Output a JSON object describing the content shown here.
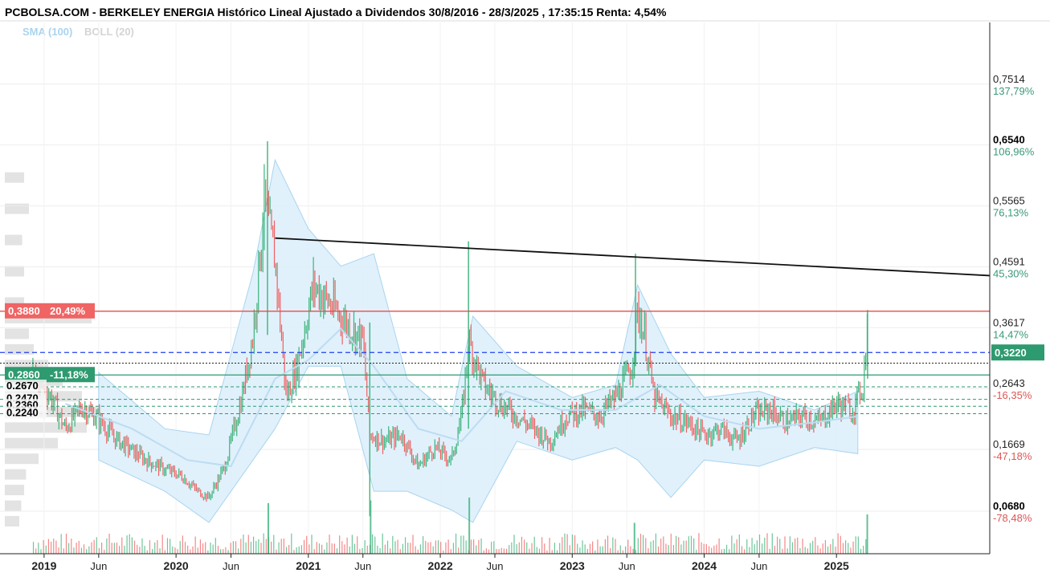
{
  "title": "PCBOLSA.COM - BERKELEY ENERGIA Histórico Lineal Ajustado a Dividendos 30/8/2016 - 28/3/2025 , 17:35:15 Renta: 4,54%",
  "legend": {
    "sma": "SMA (100)",
    "boll": "BOLL (20)"
  },
  "colors": {
    "up": "#3cb37a",
    "down": "#f06060",
    "band_fill": "#dbeefb",
    "band_line": "#a9d4ef",
    "resistance": "#e74c4c",
    "support": "#2e9a6f",
    "blue_dash": "#1f3ff0",
    "trendline": "#111111"
  },
  "chart_data": {
    "type": "line",
    "scale": "linear",
    "x_range": [
      "2018-09-01",
      "2026-03-01"
    ],
    "y_range": [
      0.0,
      0.85
    ],
    "x_ticks": [
      {
        "label": "2019",
        "date": "2019-01-01",
        "kind": "year"
      },
      {
        "label": "Jun",
        "date": "2019-06-01",
        "kind": "month"
      },
      {
        "label": "2020",
        "date": "2020-01-01",
        "kind": "year"
      },
      {
        "label": "Jun",
        "date": "2020-06-01",
        "kind": "month"
      },
      {
        "label": "2021",
        "date": "2021-01-01",
        "kind": "year"
      },
      {
        "label": "Jun",
        "date": "2021-06-01",
        "kind": "month"
      },
      {
        "label": "2022",
        "date": "2022-01-01",
        "kind": "year"
      },
      {
        "label": "Jun",
        "date": "2022-06-01",
        "kind": "month"
      },
      {
        "label": "2023",
        "date": "2023-01-01",
        "kind": "year"
      },
      {
        "label": "Jun",
        "date": "2023-06-01",
        "kind": "month"
      },
      {
        "label": "2024",
        "date": "2024-01-01",
        "kind": "year"
      },
      {
        "label": "Jun",
        "date": "2024-06-01",
        "kind": "month"
      },
      {
        "label": "2025",
        "date": "2025-01-01",
        "kind": "year"
      }
    ],
    "y_ticks": [
      {
        "price": 0.7514,
        "label": "0,7514",
        "pct": "137,79%",
        "bold": false
      },
      {
        "price": 0.654,
        "label": "0,6540",
        "pct": "106,96%",
        "bold": true
      },
      {
        "price": 0.5565,
        "label": "0,5565",
        "pct": "76,13%",
        "bold": false
      },
      {
        "price": 0.4591,
        "label": "0,4591",
        "pct": "45,30%",
        "bold": false
      },
      {
        "price": 0.3617,
        "label": "0,3617",
        "pct": "14,47%",
        "bold": false
      },
      {
        "price": 0.2643,
        "label": "0,2643",
        "pct": "-16,35%",
        "bold": false
      },
      {
        "price": 0.1669,
        "label": "0,1669",
        "pct": "-47,18%",
        "bold": false
      },
      {
        "price": 0.068,
        "label": "0,0680",
        "pct": "-78,48%",
        "bold": true
      }
    ],
    "price_series": [
      {
        "date": "2018-12-01",
        "close": 0.29
      },
      {
        "date": "2019-01-15",
        "close": 0.255
      },
      {
        "date": "2019-03-01",
        "close": 0.2
      },
      {
        "date": "2019-04-15",
        "close": 0.235
      },
      {
        "date": "2019-06-01",
        "close": 0.215
      },
      {
        "date": "2019-07-15",
        "close": 0.185
      },
      {
        "date": "2019-09-01",
        "close": 0.165
      },
      {
        "date": "2019-10-15",
        "close": 0.148
      },
      {
        "date": "2019-12-01",
        "close": 0.135
      },
      {
        "date": "2020-01-15",
        "close": 0.125
      },
      {
        "date": "2020-03-01",
        "close": 0.1
      },
      {
        "date": "2020-04-01",
        "close": 0.09
      },
      {
        "date": "2020-05-15",
        "close": 0.14
      },
      {
        "date": "2020-07-01",
        "close": 0.25
      },
      {
        "date": "2020-08-01",
        "close": 0.35
      },
      {
        "date": "2020-09-01",
        "close": 0.56
      },
      {
        "date": "2020-10-01",
        "close": 0.47
      },
      {
        "date": "2020-11-01",
        "close": 0.25
      },
      {
        "date": "2020-12-01",
        "close": 0.3
      },
      {
        "date": "2021-01-15",
        "close": 0.43
      },
      {
        "date": "2021-03-01",
        "close": 0.4
      },
      {
        "date": "2021-04-15",
        "close": 0.37
      },
      {
        "date": "2021-06-01",
        "close": 0.34
      },
      {
        "date": "2021-06-20",
        "close": 0.19
      },
      {
        "date": "2021-08-01",
        "close": 0.18
      },
      {
        "date": "2021-09-15",
        "close": 0.19
      },
      {
        "date": "2021-11-01",
        "close": 0.14
      },
      {
        "date": "2021-12-15",
        "close": 0.17
      },
      {
        "date": "2022-02-01",
        "close": 0.15
      },
      {
        "date": "2022-03-01",
        "close": 0.22
      },
      {
        "date": "2022-03-20",
        "close": 0.34
      },
      {
        "date": "2022-05-01",
        "close": 0.27
      },
      {
        "date": "2022-06-15",
        "close": 0.24
      },
      {
        "date": "2022-08-01",
        "close": 0.22
      },
      {
        "date": "2022-09-15",
        "close": 0.2
      },
      {
        "date": "2022-11-01",
        "close": 0.18
      },
      {
        "date": "2022-12-15",
        "close": 0.22
      },
      {
        "date": "2023-02-01",
        "close": 0.23
      },
      {
        "date": "2023-03-15",
        "close": 0.22
      },
      {
        "date": "2023-05-01",
        "close": 0.25
      },
      {
        "date": "2023-06-15",
        "close": 0.3
      },
      {
        "date": "2023-07-01",
        "close": 0.39
      },
      {
        "date": "2023-07-20",
        "close": 0.35
      },
      {
        "date": "2023-08-15",
        "close": 0.25
      },
      {
        "date": "2023-10-01",
        "close": 0.22
      },
      {
        "date": "2023-11-15",
        "close": 0.21
      },
      {
        "date": "2024-01-01",
        "close": 0.19
      },
      {
        "date": "2024-02-15",
        "close": 0.2
      },
      {
        "date": "2024-04-01",
        "close": 0.18
      },
      {
        "date": "2024-05-15",
        "close": 0.22
      },
      {
        "date": "2024-07-01",
        "close": 0.23
      },
      {
        "date": "2024-08-15",
        "close": 0.21
      },
      {
        "date": "2024-10-01",
        "close": 0.22
      },
      {
        "date": "2024-11-15",
        "close": 0.21
      },
      {
        "date": "2025-01-01",
        "close": 0.24
      },
      {
        "date": "2025-02-15",
        "close": 0.23
      },
      {
        "date": "2025-03-15",
        "close": 0.27
      },
      {
        "date": "2025-03-28",
        "close": 0.37
      }
    ],
    "sma_series": [
      {
        "date": "2019-03-01",
        "value": 0.24
      },
      {
        "date": "2019-09-01",
        "value": 0.2
      },
      {
        "date": "2020-02-01",
        "value": 0.15
      },
      {
        "date": "2020-06-01",
        "value": 0.14
      },
      {
        "date": "2020-10-01",
        "value": 0.28
      },
      {
        "date": "2021-01-01",
        "value": 0.31
      },
      {
        "date": "2021-04-01",
        "value": 0.36
      },
      {
        "date": "2021-07-01",
        "value": 0.3
      },
      {
        "date": "2021-11-01",
        "value": 0.2
      },
      {
        "date": "2022-03-01",
        "value": 0.18
      },
      {
        "date": "2022-07-01",
        "value": 0.26
      },
      {
        "date": "2022-12-01",
        "value": 0.23
      },
      {
        "date": "2023-05-01",
        "value": 0.23
      },
      {
        "date": "2023-09-01",
        "value": 0.27
      },
      {
        "date": "2024-01-01",
        "value": 0.22
      },
      {
        "date": "2024-06-01",
        "value": 0.2
      },
      {
        "date": "2024-11-01",
        "value": 0.21
      },
      {
        "date": "2025-03-01",
        "value": 0.22
      }
    ],
    "boll_band": [
      {
        "date": "2019-06-01",
        "upper": 0.29,
        "lower": 0.15
      },
      {
        "date": "2019-12-01",
        "upper": 0.2,
        "lower": 0.1
      },
      {
        "date": "2020-04-01",
        "upper": 0.19,
        "lower": 0.05
      },
      {
        "date": "2020-08-01",
        "upper": 0.45,
        "lower": 0.15
      },
      {
        "date": "2020-10-01",
        "upper": 0.63,
        "lower": 0.2
      },
      {
        "date": "2021-01-01",
        "upper": 0.52,
        "lower": 0.3
      },
      {
        "date": "2021-04-01",
        "upper": 0.46,
        "lower": 0.3
      },
      {
        "date": "2021-07-01",
        "upper": 0.48,
        "lower": 0.1
      },
      {
        "date": "2021-10-01",
        "upper": 0.28,
        "lower": 0.1
      },
      {
        "date": "2022-02-01",
        "upper": 0.22,
        "lower": 0.07
      },
      {
        "date": "2022-04-01",
        "upper": 0.38,
        "lower": 0.05
      },
      {
        "date": "2022-08-01",
        "upper": 0.3,
        "lower": 0.18
      },
      {
        "date": "2023-01-01",
        "upper": 0.25,
        "lower": 0.15
      },
      {
        "date": "2023-05-01",
        "upper": 0.27,
        "lower": 0.17
      },
      {
        "date": "2023-07-01",
        "upper": 0.43,
        "lower": 0.15
      },
      {
        "date": "2023-10-01",
        "upper": 0.32,
        "lower": 0.09
      },
      {
        "date": "2024-01-01",
        "upper": 0.25,
        "lower": 0.15
      },
      {
        "date": "2024-06-01",
        "upper": 0.26,
        "lower": 0.14
      },
      {
        "date": "2024-11-01",
        "upper": 0.23,
        "lower": 0.17
      },
      {
        "date": "2025-03-01",
        "upper": 0.26,
        "lower": 0.16
      }
    ],
    "trendline": {
      "start": {
        "date": "2020-10-01",
        "price": 0.505
      },
      "end": {
        "date": "2026-03-01",
        "price": 0.445
      }
    },
    "level_tags": [
      {
        "label": "0,3880",
        "pct": "20,49%",
        "price": 0.388,
        "style": "resistance"
      },
      {
        "label": "0.2860",
        "pct": "-11,18%",
        "price": 0.286,
        "style": "support"
      },
      {
        "label": "0.2670",
        "price": 0.267,
        "style": "plain"
      },
      {
        "label": "0.2470",
        "price": 0.247,
        "style": "plain"
      },
      {
        "label": "0.2360",
        "price": 0.236,
        "style": "plain"
      },
      {
        "label": "0.2240",
        "price": 0.224,
        "style": "plain"
      }
    ],
    "current_price_tag": {
      "label": "0,3220",
      "price": 0.322
    },
    "current_price_dotted": 0.305,
    "volume_profile": [
      {
        "price": 0.05,
        "weight": 0.15
      },
      {
        "price": 0.075,
        "weight": 0.17
      },
      {
        "price": 0.1,
        "weight": 0.2
      },
      {
        "price": 0.125,
        "weight": 0.22
      },
      {
        "price": 0.15,
        "weight": 0.35
      },
      {
        "price": 0.175,
        "weight": 0.55
      },
      {
        "price": 0.2,
        "weight": 0.85
      },
      {
        "price": 0.225,
        "weight": 1.0
      },
      {
        "price": 0.25,
        "weight": 0.8
      },
      {
        "price": 0.275,
        "weight": 0.6
      },
      {
        "price": 0.3,
        "weight": 0.45
      },
      {
        "price": 0.325,
        "weight": 0.3
      },
      {
        "price": 0.35,
        "weight": 0.25
      },
      {
        "price": 0.375,
        "weight": 0.9
      },
      {
        "price": 0.4,
        "weight": 0.2
      },
      {
        "price": 0.45,
        "weight": 0.2
      },
      {
        "price": 0.5,
        "weight": 0.18
      },
      {
        "price": 0.55,
        "weight": 0.25
      },
      {
        "price": 0.6,
        "weight": 0.2
      }
    ],
    "volume_spikes": [
      {
        "date": "2020-09-10",
        "height": 0.9
      },
      {
        "date": "2021-06-20",
        "height": 0.95
      },
      {
        "date": "2022-03-20",
        "height": 1.0
      },
      {
        "date": "2023-06-20",
        "height": 0.55
      },
      {
        "date": "2025-03-25",
        "height": 0.7
      }
    ]
  }
}
